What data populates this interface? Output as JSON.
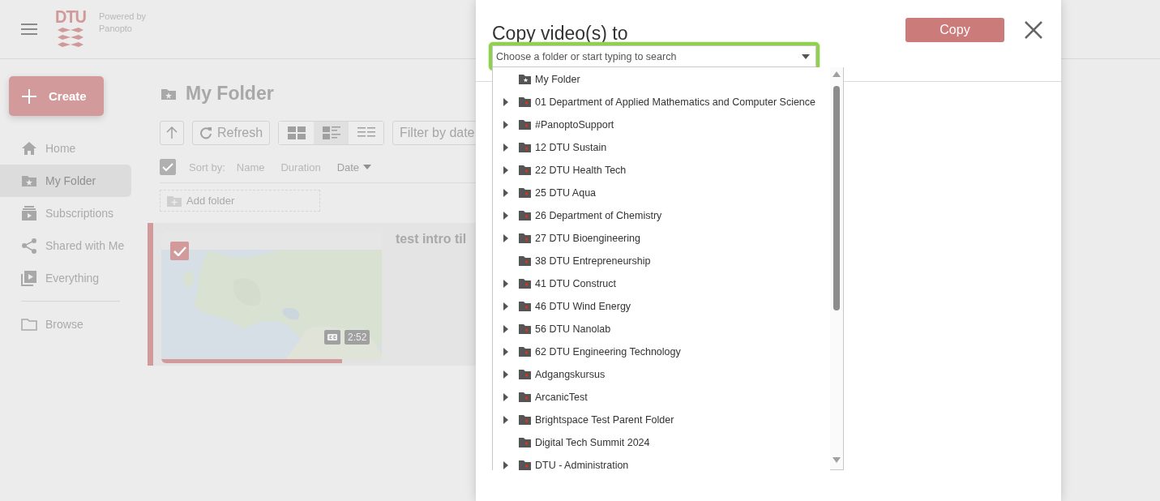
{
  "header": {
    "powered_by": "Powered by",
    "brand": "Panopto",
    "logo_text": "DTU"
  },
  "sidebar": {
    "create_label": "Create",
    "items": [
      {
        "label": "Home",
        "kind": "home",
        "selected": false
      },
      {
        "label": "My Folder",
        "kind": "personal",
        "selected": true
      },
      {
        "label": "Subscriptions",
        "kind": "subscriptions",
        "selected": false
      },
      {
        "label": "Shared with Me",
        "kind": "shared",
        "selected": false
      },
      {
        "label": "Everything",
        "kind": "everything",
        "selected": false
      },
      {
        "label": "Browse",
        "kind": "browse",
        "selected": false,
        "separated": true
      }
    ]
  },
  "content": {
    "title": "My Folder",
    "refresh_label": "Refresh",
    "filter_label": "Filter by date",
    "views": [
      {
        "kind": "grid",
        "selected": false
      },
      {
        "kind": "detail",
        "selected": true
      },
      {
        "kind": "list",
        "selected": false
      }
    ],
    "select_all_checked": true,
    "sort_label": "Sort by:",
    "sort_options": [
      {
        "label": "Name",
        "selected": false
      },
      {
        "label": "Duration",
        "selected": false
      },
      {
        "label": "Date",
        "selected": true
      }
    ],
    "add_folder_label": "Add folder",
    "videos": [
      {
        "title": "test intro til",
        "duration": "2:52",
        "captions": true,
        "checked": true,
        "level": 0.82
      }
    ]
  },
  "dialog": {
    "title": "Copy video(s) to",
    "copy_label": "Copy",
    "search": {
      "placeholder": "Choose a folder or start typing to search"
    },
    "folders": [
      {
        "name": "My Folder",
        "kind": "personal",
        "expandable": false
      },
      {
        "name": "01 Department of Applied Mathematics and Computer Science",
        "kind": "shared",
        "expandable": true
      },
      {
        "name": "#PanoptoSupport",
        "kind": "shared",
        "expandable": true
      },
      {
        "name": "12 DTU Sustain",
        "kind": "shared",
        "expandable": true
      },
      {
        "name": "22 DTU Health Tech",
        "kind": "shared",
        "expandable": true
      },
      {
        "name": "25 DTU Aqua",
        "kind": "shared",
        "expandable": true
      },
      {
        "name": "26 Department of Chemistry",
        "kind": "shared",
        "expandable": true
      },
      {
        "name": "27 DTU Bioengineering",
        "kind": "shared",
        "expandable": true
      },
      {
        "name": "38 DTU Entrepreneurship",
        "kind": "shared",
        "expandable": false
      },
      {
        "name": "41 DTU Construct",
        "kind": "shared",
        "expandable": true
      },
      {
        "name": "46 DTU Wind Energy",
        "kind": "shared",
        "expandable": true
      },
      {
        "name": "56 DTU Nanolab",
        "kind": "shared",
        "expandable": true
      },
      {
        "name": "62 DTU Engineering Technology",
        "kind": "shared",
        "expandable": true
      },
      {
        "name": "Adgangskursus",
        "kind": "shared",
        "expandable": true
      },
      {
        "name": "ArcanicTest",
        "kind": "shared",
        "expandable": true
      },
      {
        "name": "Brightspace Test Parent Folder",
        "kind": "shared",
        "expandable": true
      },
      {
        "name": "Digital Tech Summit 2024",
        "kind": "shared",
        "expandable": false
      },
      {
        "name": "DTU - Administration",
        "kind": "shared",
        "expandable": true
      }
    ]
  }
}
